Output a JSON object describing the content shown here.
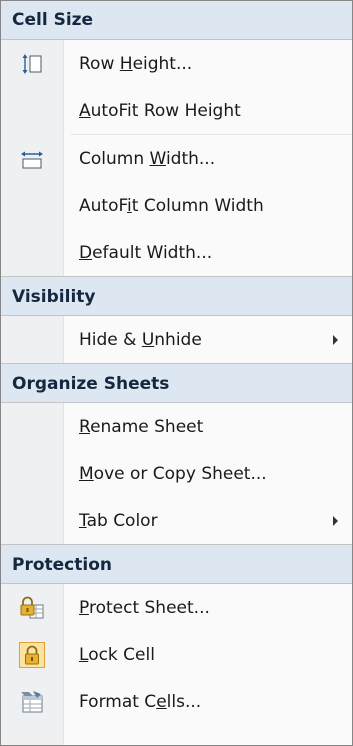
{
  "sections": {
    "cell_size": {
      "title": "Cell Size",
      "row_height": {
        "pre": "Row ",
        "acc": "H",
        "post": "eight..."
      },
      "autofit_row_height": {
        "pre": "",
        "acc": "A",
        "post": "utoFit Row Height"
      },
      "column_width": {
        "pre": "Column ",
        "acc": "W",
        "post": "idth..."
      },
      "autofit_column_width": {
        "pre": "AutoF",
        "acc": "i",
        "post": "t Column Width"
      },
      "default_width": {
        "pre": "",
        "acc": "D",
        "post": "efault Width..."
      }
    },
    "visibility": {
      "title": "Visibility",
      "hide_unhide": {
        "pre": "Hide & ",
        "acc": "U",
        "post": "nhide"
      }
    },
    "organize_sheets": {
      "title": "Organize Sheets",
      "rename_sheet": {
        "pre": "",
        "acc": "R",
        "post": "ename Sheet"
      },
      "move_copy_sheet": {
        "pre": "",
        "acc": "M",
        "post": "ove or Copy Sheet..."
      },
      "tab_color": {
        "pre": "",
        "acc": "T",
        "post": "ab Color"
      }
    },
    "protection": {
      "title": "Protection",
      "protect_sheet": {
        "pre": "",
        "acc": "P",
        "post": "rotect Sheet..."
      },
      "lock_cell": {
        "pre": "",
        "acc": "L",
        "post": "ock Cell"
      },
      "format_cells": {
        "pre": "Format C",
        "acc": "e",
        "post": "lls..."
      }
    }
  },
  "icons": {
    "row_height": "row-height-icon",
    "column_width": "column-width-icon",
    "protect_sheet": "protect-sheet-icon",
    "lock_cell": "lock-cell-icon",
    "format_cells": "format-cells-icon"
  },
  "colors": {
    "header_bg": "#dde7f1",
    "header_text": "#15283f",
    "gutter": "#eef0f2",
    "lock_highlight": "#fde3a0"
  }
}
